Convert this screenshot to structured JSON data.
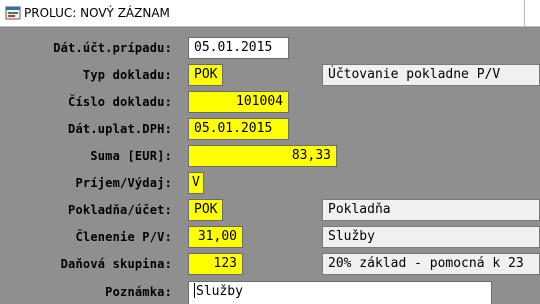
{
  "window": {
    "title": "PROLUC: NOVÝ ZÁZNAM",
    "icon": "app-window-icon"
  },
  "fields": {
    "dat_uct_pripadu": {
      "label": "Dát.účt.prípadu:",
      "value": "05.01.2015"
    },
    "typ_dokladu": {
      "label": "Typ dokladu:",
      "value": "POK",
      "description": "Účtovanie pokladne P/V"
    },
    "cislo_dokladu": {
      "label": "Číslo dokladu:",
      "value": "101004"
    },
    "dat_uplat_dph": {
      "label": "Dát.uplat.DPH:",
      "value": "05.01.2015"
    },
    "suma": {
      "label": "Suma [EUR]:",
      "value": "83,33"
    },
    "prijem_vydaj": {
      "label": "Príjem/Výdaj:",
      "value": "V"
    },
    "pokladna_ucet": {
      "label": "Pokladňa/účet:",
      "value": "POK",
      "description": "Pokladňa"
    },
    "clenenie_pv": {
      "label": "Členenie P/V:",
      "value": "31,00",
      "description": "Služby"
    },
    "danova_skupina": {
      "label": "Daňová skupina:",
      "value": "123",
      "description": "20% základ - pomocná k 23"
    },
    "poznamka": {
      "label": "Poznámka:",
      "value": "Služby"
    }
  },
  "colors": {
    "background": "#8f8f8f",
    "input_white": "#ffffff",
    "input_highlight": "#ffff00",
    "description_box": "#f0f0f0"
  }
}
